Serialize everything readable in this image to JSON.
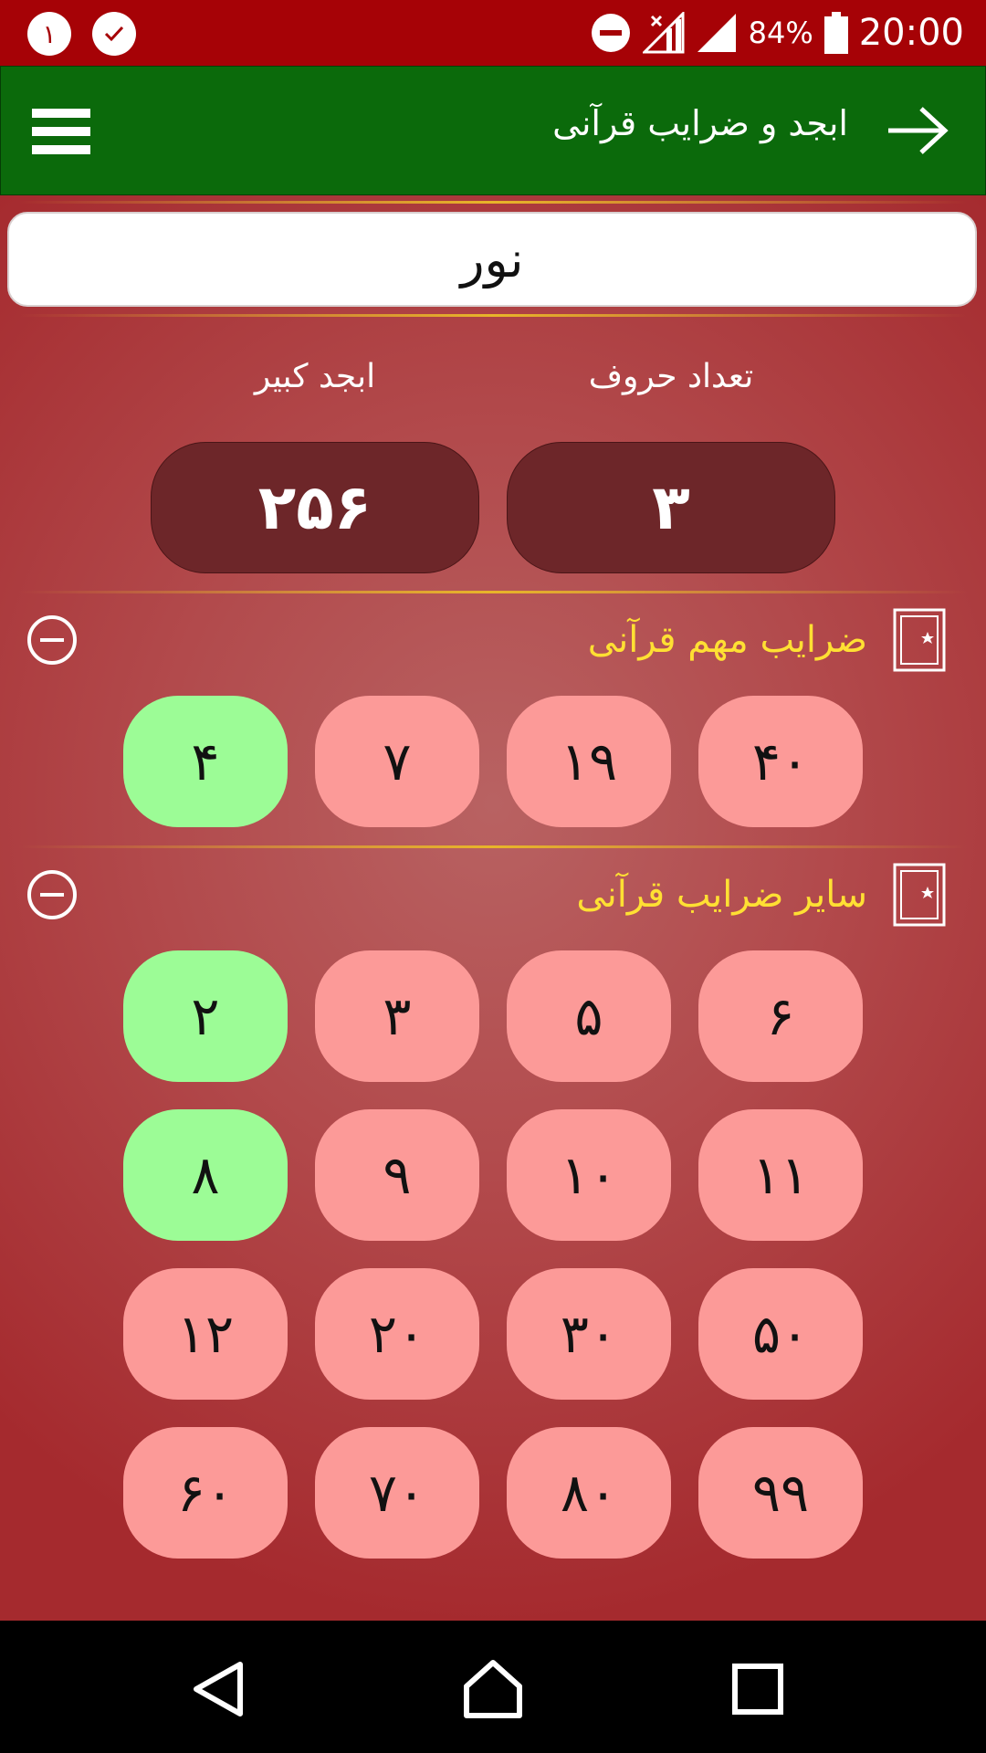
{
  "status_bar": {
    "notification_count": "١",
    "battery": "84%",
    "time": "20:00"
  },
  "app_bar": {
    "title": "ابجد و ضرایب قرآنی"
  },
  "search": {
    "value": "نور"
  },
  "stats": {
    "letters_label": "تعداد حروف",
    "letters_value": "۳",
    "abjad_label": "ابجد کبیر",
    "abjad_value": "۲۵۶"
  },
  "important_section": {
    "title": "ضرایب مهم قرآنی",
    "chips": [
      {
        "label": "۴۰",
        "state": "red"
      },
      {
        "label": "۱۹",
        "state": "red"
      },
      {
        "label": "۷",
        "state": "red"
      },
      {
        "label": "۴",
        "state": "green"
      }
    ]
  },
  "other_section": {
    "title": "سایر ضرایب قرآنی",
    "chips": [
      {
        "label": "۶",
        "state": "red"
      },
      {
        "label": "۵",
        "state": "red"
      },
      {
        "label": "۳",
        "state": "red"
      },
      {
        "label": "۲",
        "state": "green"
      },
      {
        "label": "۱۱",
        "state": "red"
      },
      {
        "label": "۱۰",
        "state": "red"
      },
      {
        "label": "۹",
        "state": "red"
      },
      {
        "label": "۸",
        "state": "green"
      },
      {
        "label": "۵۰",
        "state": "red"
      },
      {
        "label": "۳۰",
        "state": "red"
      },
      {
        "label": "۲۰",
        "state": "red"
      },
      {
        "label": "۱۲",
        "state": "red"
      },
      {
        "label": "۹۹",
        "state": "red"
      },
      {
        "label": "۸۰",
        "state": "red"
      },
      {
        "label": "۷۰",
        "state": "red"
      },
      {
        "label": "۶۰",
        "state": "red"
      }
    ]
  },
  "colors": {
    "status_bar": "#a60206",
    "app_bar": "#0b6a0b",
    "section_title": "#ffe033",
    "chip_red": "#fc9a98",
    "chip_green": "#9cfc96",
    "stat_box": "#6d2629"
  }
}
